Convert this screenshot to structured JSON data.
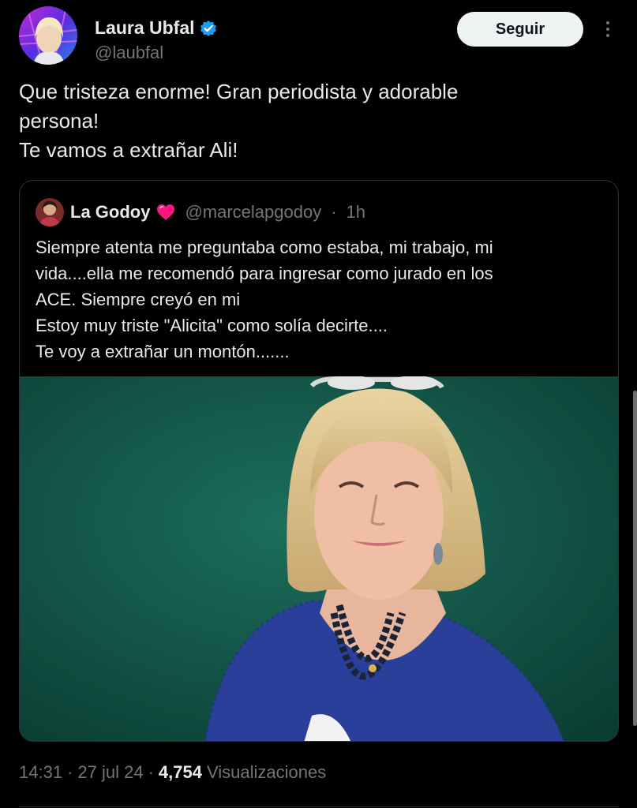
{
  "author": {
    "name": "Laura Ubfal",
    "handle": "@laubfal",
    "follow_label": "Seguir"
  },
  "tweet": {
    "lines": [
      "Que tristeza enorme! Gran periodista y adorable",
      "persona!",
      "Te vamos a extrañar Ali!"
    ]
  },
  "quote": {
    "name": "La Godoy",
    "handle": "@marcelapgodoy",
    "separator": "·",
    "time": "1h",
    "lines": [
      "Siempre atenta me preguntaba como estaba, mi trabajo, mi",
      "vida....ella me recomendó para ingresar como jurado en los",
      "ACE. Siempre creyó en mi",
      "Estoy muy triste \"Alicita\" como solía decirte....",
      "Te voy a extrañar un montón......."
    ]
  },
  "footer": {
    "time": "14:31",
    "sep1": "·",
    "date": "27 jul 24",
    "sep2": "·",
    "views_count": "4,754",
    "views_label": "Visualizaciones"
  },
  "colors": {
    "background": "#000000",
    "text": "#e7e9ea",
    "muted": "#71767b",
    "verified": "#1d9bf0",
    "heart": "#f91880",
    "photo_background": "#0f5446"
  },
  "icons": {
    "verified": "verified-badge-icon",
    "more": "more-options-icon",
    "heart": "pink-heart-icon"
  }
}
